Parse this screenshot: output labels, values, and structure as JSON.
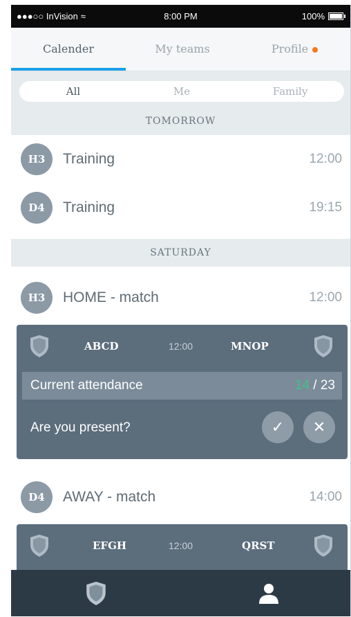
{
  "status_bar": {
    "carrier": "●●●○○ InVision",
    "time": "8:00 PM",
    "battery": "100%"
  },
  "tabs": [
    {
      "label": "Calender",
      "active": true
    },
    {
      "label": "My teams",
      "active": false
    },
    {
      "label": "Profile",
      "active": false,
      "notification_dot": true
    }
  ],
  "filters": [
    {
      "label": "All",
      "active": true
    },
    {
      "label": "Me",
      "active": false
    },
    {
      "label": "Family",
      "active": false
    }
  ],
  "sections": [
    {
      "header": "TOMORROW",
      "events": [
        {
          "badge": "H3",
          "title": "Training",
          "time": "12:00"
        },
        {
          "badge": "D4",
          "title": "Training",
          "time": "19:15"
        }
      ]
    },
    {
      "header": "SATURDAY",
      "events": [
        {
          "badge": "H3",
          "title": "HOME - match",
          "time": "12:00",
          "match": {
            "home": "ABCD",
            "time": "12:00",
            "away": "MNOP",
            "attendance_label": "Current attendance",
            "attendance_present": "14",
            "attendance_total": "/ 23",
            "question": "Are you present?",
            "confirm_icon": "check-icon",
            "decline_icon": "close-icon"
          }
        },
        {
          "badge": "D4",
          "title": "AWAY - match",
          "time": "14:00",
          "match": {
            "home": "EFGH",
            "time": "12:00",
            "away": "QRST"
          }
        }
      ]
    }
  ],
  "bottom_nav": [
    {
      "icon": "shield-icon"
    },
    {
      "icon": "user-icon"
    }
  ],
  "colors": {
    "accent": "#1aa0e8",
    "notification": "#f47a20",
    "present": "#3fc28a",
    "card": "#5c6d7c"
  }
}
